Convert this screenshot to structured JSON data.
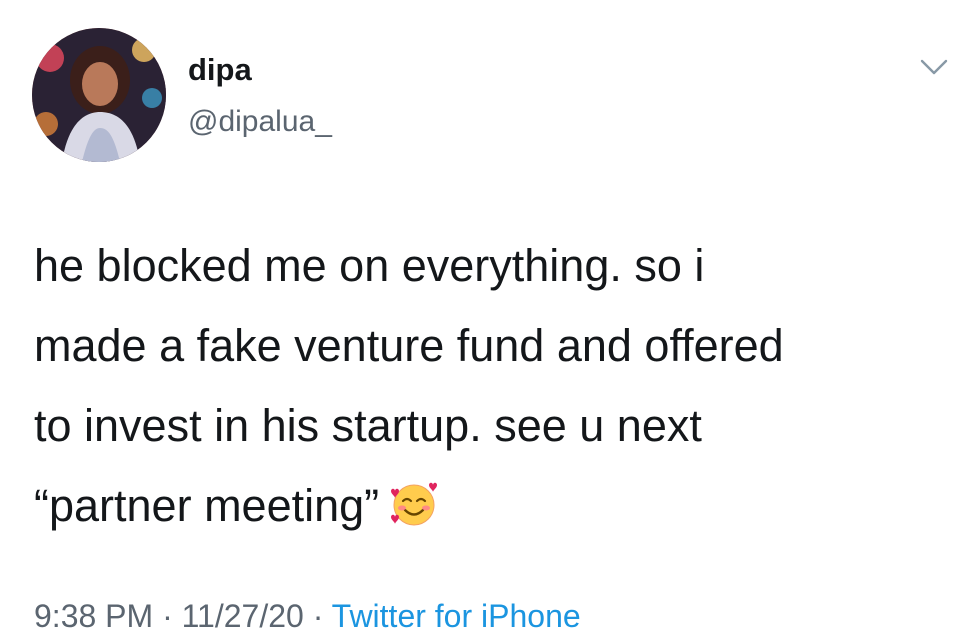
{
  "tweet": {
    "author": {
      "display_name": "dipa",
      "handle": "@dipalua_",
      "avatar_icon": "profile-photo"
    },
    "menu_icon": "chevron-down-icon",
    "text": "he blocked me on everything. so i\nmade a fake venture fund and offered\nto invest in his startup. see u next\n“partner meeting”",
    "emoji_icon": "smiling-face-with-hearts-emoji",
    "time": "9:38 PM",
    "date": "11/27/20",
    "separator": "·",
    "source": "Twitter for iPhone"
  },
  "colors": {
    "text_primary": "#14171a",
    "text_secondary": "#5b6570",
    "link": "#1b95e0"
  }
}
